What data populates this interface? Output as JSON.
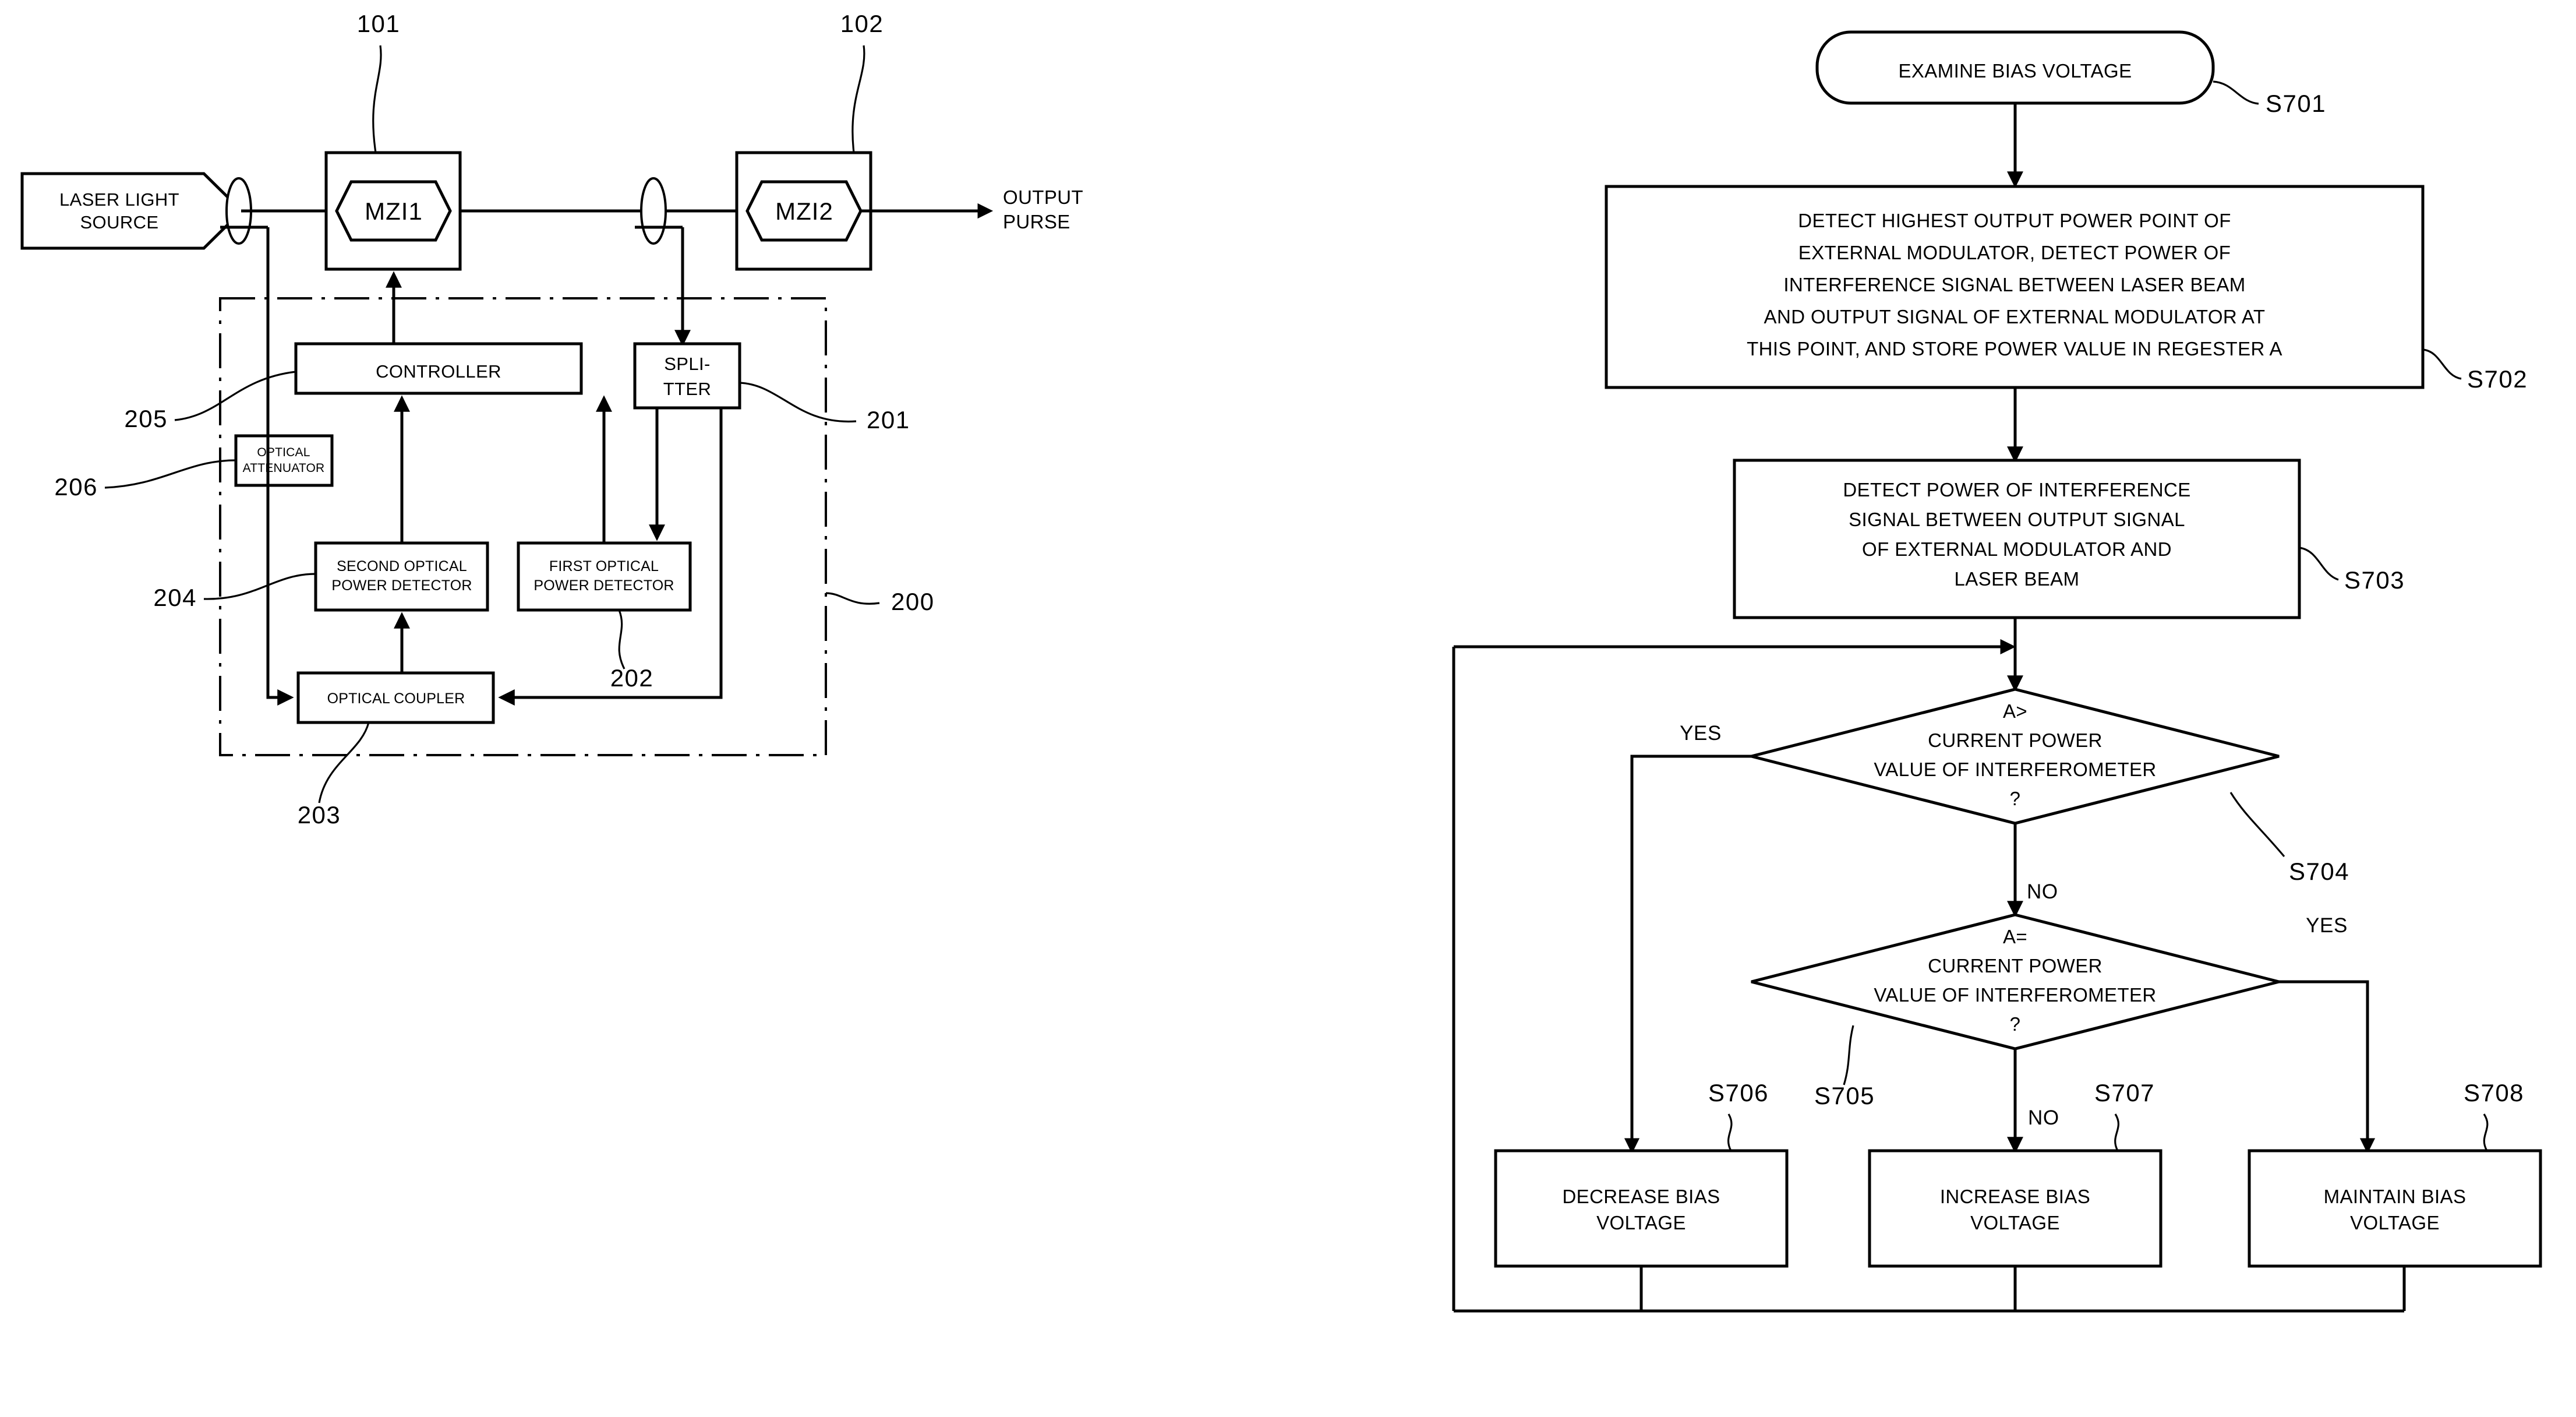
{
  "figure_left": {
    "name": "optical-modulator-block-diagram",
    "blocks": {
      "laser_source": "LASER LIGHT\nSOURCE",
      "laser_source_line1": "LASER LIGHT",
      "laser_source_line2": "SOURCE",
      "mzi1": "MZI1",
      "mzi2": "MZI2",
      "output": "OUTPUT\nPURSE",
      "output_line1": "OUTPUT",
      "output_line2": "PURSE",
      "controller": "CONTROLLER",
      "splitter_line1": "SPLI-",
      "splitter_line2": "TTER",
      "optical_attenuator_line1": "OPTICAL",
      "optical_attenuator_line2": "ATTENUATOR",
      "second_detector_line1": "SECOND OPTICAL",
      "second_detector_line2": "POWER DETECTOR",
      "first_detector_line1": "FIRST OPTICAL",
      "first_detector_line2": "POWER DETECTOR",
      "optical_coupler": "OPTICAL COUPLER"
    },
    "refs": {
      "r101": "101",
      "r102": "102",
      "r200": "200",
      "r201": "201",
      "r202": "202",
      "r203": "203",
      "r204": "204",
      "r205": "205",
      "r206": "206"
    }
  },
  "figure_right": {
    "name": "bias-voltage-control-flowchart",
    "steps": {
      "s701": {
        "id": "S701",
        "text": "EXAMINE BIAS VOLTAGE",
        "lines": [
          "EXAMINE BIAS VOLTAGE"
        ],
        "shape": "rounded-terminator"
      },
      "s702": {
        "id": "S702",
        "lines": [
          "DETECT HIGHEST OUTPUT POWER POINT OF",
          "EXTERNAL MODULATOR, DETECT POWER OF",
          "INTERFERENCE SIGNAL BETWEEN LASER BEAM",
          "AND OUTPUT SIGNAL OF EXTERNAL MODULATOR AT",
          "THIS POINT, AND STORE POWER VALUE IN REGESTER A"
        ],
        "shape": "process"
      },
      "s703": {
        "id": "S703",
        "lines": [
          "DETECT POWER OF INTERFERENCE",
          "SIGNAL BETWEEN OUTPUT SIGNAL",
          "OF EXTERNAL MODULATOR AND",
          "LASER BEAM"
        ],
        "shape": "process"
      },
      "s704": {
        "id": "S704",
        "lines": [
          "A>",
          "CURRENT POWER",
          "VALUE OF INTERFEROMETER",
          "?"
        ],
        "shape": "decision",
        "yes_label": "YES",
        "no_label": "NO",
        "yes_target": "S706",
        "no_target": "S705"
      },
      "s705": {
        "id": "S705",
        "lines": [
          "A=",
          "CURRENT POWER",
          "VALUE OF INTERFEROMETER",
          "?"
        ],
        "shape": "decision",
        "yes_label": "YES",
        "no_label": "NO",
        "yes_target": "S708",
        "no_target": "S707"
      },
      "s706": {
        "id": "S706",
        "lines": [
          "DECREASE BIAS",
          "VOLTAGE"
        ],
        "shape": "process"
      },
      "s707": {
        "id": "S707",
        "lines": [
          "INCREASE BIAS",
          "VOLTAGE"
        ],
        "shape": "process"
      },
      "s708": {
        "id": "S708",
        "lines": [
          "MAINTAIN BIAS",
          "VOLTAGE"
        ],
        "shape": "process"
      }
    }
  },
  "colors": {
    "ink": "#000000",
    "paper": "#ffffff"
  }
}
